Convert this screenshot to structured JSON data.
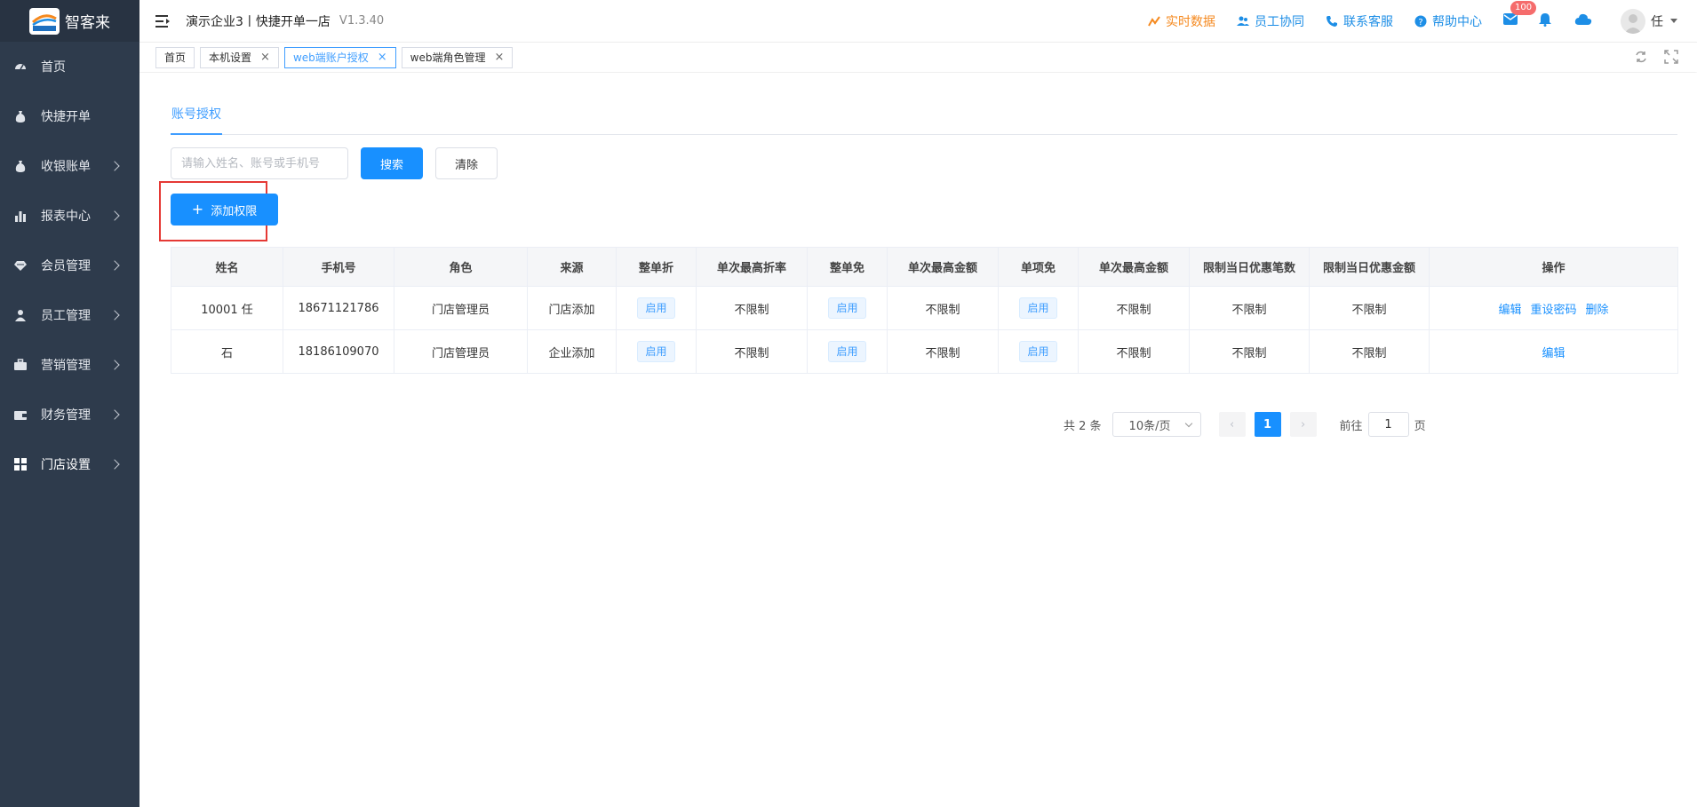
{
  "app": {
    "logo_text": "智客来",
    "logo_badge_text": "智客来"
  },
  "sidebar": {
    "items": [
      {
        "label": "首页",
        "icon": "dashboard-icon",
        "has_children": false
      },
      {
        "label": "快捷开单",
        "icon": "money-bag-icon",
        "has_children": false
      },
      {
        "label": "收银账单",
        "icon": "money-bag-icon",
        "has_children": true
      },
      {
        "label": "报表中心",
        "icon": "bar-chart-icon",
        "has_children": true
      },
      {
        "label": "会员管理",
        "icon": "diamond-icon",
        "has_children": true
      },
      {
        "label": "员工管理",
        "icon": "user-icon",
        "has_children": true
      },
      {
        "label": "营销管理",
        "icon": "briefcase-icon",
        "has_children": true
      },
      {
        "label": "财务管理",
        "icon": "wallet-icon",
        "has_children": true
      },
      {
        "label": "门店设置",
        "icon": "grid-icon",
        "has_children": true,
        "active": true
      }
    ]
  },
  "header": {
    "breadcrumb": "演示企业3丨快捷开单一店",
    "version": "V1.3.40",
    "links": {
      "realtime": "实时数据",
      "staff": "员工协同",
      "support": "联系客服",
      "help": "帮助中心"
    },
    "mail_badge": "100",
    "user_name": "任"
  },
  "tabs": [
    {
      "label": "首页",
      "closable": false,
      "active": false
    },
    {
      "label": "本机设置",
      "closable": true,
      "active": false
    },
    {
      "label": "web端账户授权",
      "closable": true,
      "active": true
    },
    {
      "label": "web端角色管理",
      "closable": true,
      "active": false
    }
  ],
  "subtab": "账号授权",
  "search": {
    "placeholder": "请输入姓名、账号或手机号",
    "value": "",
    "search_label": "搜索",
    "clear_label": "清除",
    "add_label": "添加权限"
  },
  "table": {
    "columns": [
      "姓名",
      "手机号",
      "角色",
      "来源",
      "整单折",
      "单次最高折率",
      "整单免",
      "单次最高金额",
      "单项免",
      "单次最高金额",
      "限制当日优惠笔数",
      "限制当日优惠金额",
      "操作"
    ],
    "rows": [
      {
        "name": "10001 任",
        "phone": "18671121786",
        "role": "门店管理员",
        "source": "门店添加",
        "whole_discount": "启用",
        "max_rate": "不限制",
        "whole_free": "启用",
        "max_amount": "不限制",
        "item_free": "启用",
        "item_max_amount": "不限制",
        "daily_count": "不限制",
        "daily_amount": "不限制",
        "ops": [
          "编辑",
          "重设密码",
          "删除"
        ]
      },
      {
        "name": "石",
        "phone": "18186109070",
        "role": "门店管理员",
        "source": "企业添加",
        "whole_discount": "启用",
        "max_rate": "不限制",
        "whole_free": "启用",
        "max_amount": "不限制",
        "item_free": "启用",
        "item_max_amount": "不限制",
        "daily_count": "不限制",
        "daily_amount": "不限制",
        "ops": [
          "编辑"
        ]
      }
    ]
  },
  "pagination": {
    "total_text": "共 2 条",
    "page_size": "10条/页",
    "current_page": "1",
    "goto_label": "前往",
    "goto_value": "1",
    "goto_suffix": "页"
  },
  "colors": {
    "sidebar_bg": "#2e3b4c",
    "primary": "#1890ff",
    "highlight_border": "#e53935",
    "orange": "#f5891f"
  }
}
